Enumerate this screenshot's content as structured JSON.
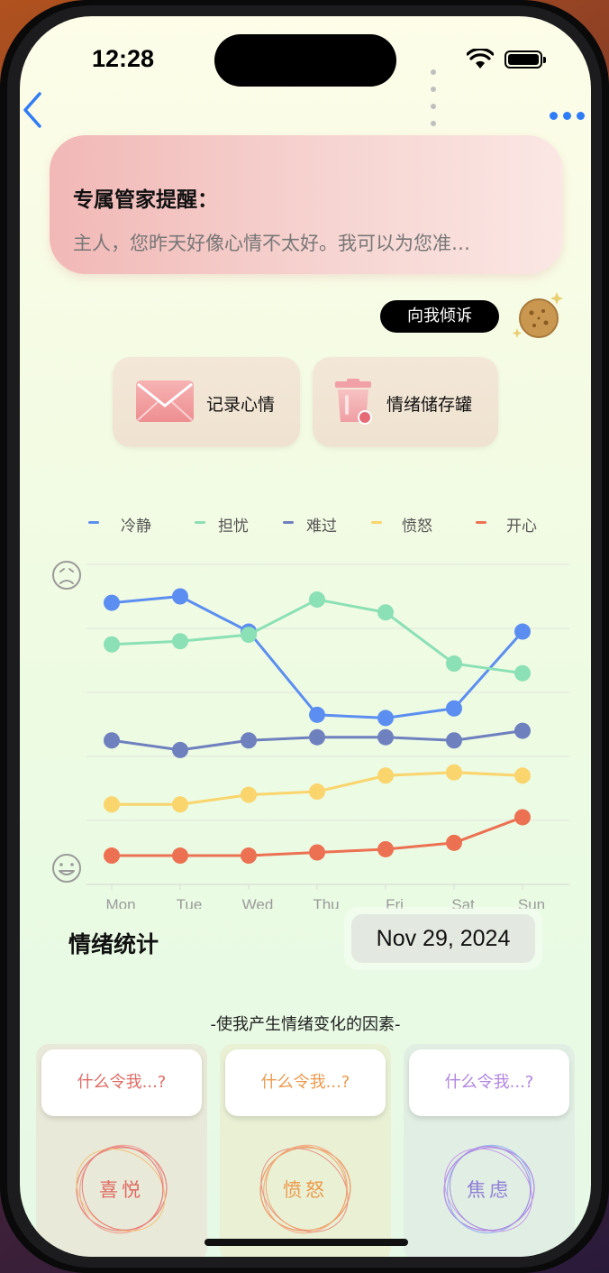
{
  "status_bar": {
    "time": "12:28"
  },
  "reminder": {
    "title": "专属管家提醒：",
    "text": "主人，您昨天好像心情不太好。我可以为您准…"
  },
  "talk_button": {
    "label": "向我倾诉"
  },
  "actions": [
    {
      "label": "记录心情"
    },
    {
      "label": "情绪储存罐"
    }
  ],
  "chart_data": {
    "type": "line",
    "x": [
      "Mon",
      "Tue",
      "Wed",
      "Thu",
      "Fri",
      "Sat",
      "Sun"
    ],
    "legend": [
      "冷静",
      "担忧",
      "难过",
      "愤怒",
      "开心"
    ],
    "series": [
      {
        "name": "冷静",
        "color": "#5b8ef0",
        "values": [
          8.8,
          9.0,
          7.9,
          5.3,
          5.2,
          5.5,
          7.9
        ]
      },
      {
        "name": "担忧",
        "color": "#8be0b5",
        "values": [
          7.5,
          7.6,
          7.8,
          8.9,
          8.5,
          6.9,
          6.6
        ]
      },
      {
        "name": "难过",
        "color": "#6f80bf",
        "values": [
          4.5,
          4.2,
          4.5,
          4.6,
          4.6,
          4.5,
          4.8
        ]
      },
      {
        "name": "愤怒",
        "color": "#fad46c",
        "values": [
          2.5,
          2.5,
          2.8,
          2.9,
          3.4,
          3.5,
          3.4
        ]
      },
      {
        "name": "开心",
        "color": "#ec7152",
        "values": [
          0.9,
          0.9,
          0.9,
          1.0,
          1.1,
          1.3,
          2.1
        ]
      }
    ],
    "ylim": [
      0,
      10
    ],
    "grid": true,
    "legend_position": "top"
  },
  "stats": {
    "title": "情绪统计",
    "date": "Nov 29, 2024"
  },
  "factors": {
    "title": "-使我产生情绪变化的因素-",
    "items": [
      {
        "question": "什么令我...?",
        "emotion": "喜悦",
        "color": "#e06a63"
      },
      {
        "question": "什么令我...?",
        "emotion": "愤怒",
        "color": "#ec9a4c"
      },
      {
        "question": "什么令我...?",
        "emotion": "焦虑",
        "color": "#b184e2"
      }
    ]
  }
}
